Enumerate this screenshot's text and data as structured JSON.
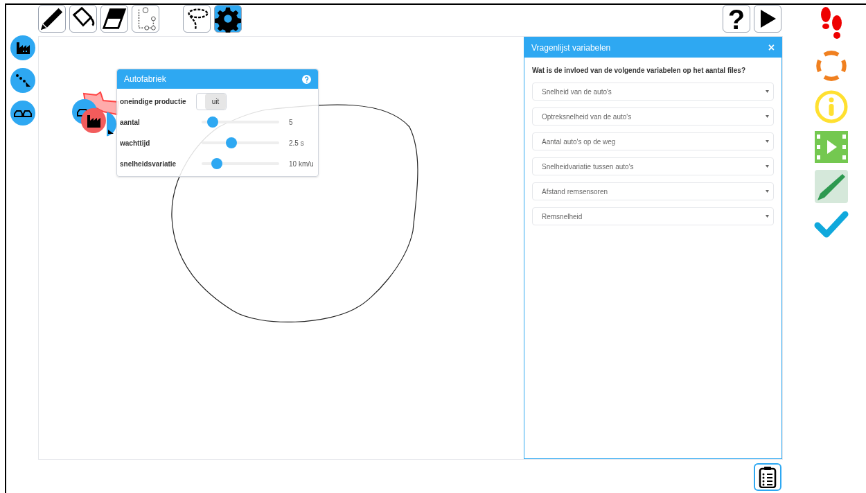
{
  "toolbar": {
    "tools": [
      {
        "kind": "pencil",
        "selected": false
      },
      {
        "kind": "bucket",
        "selected": false
      },
      {
        "kind": "eraser",
        "selected": false
      },
      {
        "kind": "select",
        "selected": false
      },
      {
        "kind": "lasso",
        "selected": false
      },
      {
        "kind": "gear",
        "selected": true
      }
    ],
    "help_label": "?"
  },
  "canvas": {
    "nodes": [
      {
        "kind": "car",
        "selected": false
      },
      {
        "kind": "factory",
        "selected": true
      }
    ]
  },
  "properties_panel": {
    "title": "Autofabriek",
    "rows": [
      {
        "kind": "toggle",
        "label": "oneindige productie",
        "value": "uit",
        "on": false
      },
      {
        "kind": "slider",
        "label": "aantal",
        "level": 0.14,
        "reading": "5"
      },
      {
        "kind": "slider",
        "label": "wachttijd",
        "level": 0.38,
        "reading": "2.5 s"
      },
      {
        "kind": "slider",
        "label": "snelheidsvariatie",
        "level": 0.2,
        "reading": "10 km/u"
      }
    ]
  },
  "questionnaire": {
    "title": "Vragenlijst variabelen",
    "close": "×",
    "question": "Wat is de invloed van de volgende variabelen op het aantal files?",
    "selects": [
      {
        "value": "Snelheid van de auto's"
      },
      {
        "value": "Optreksnelheid van de auto's"
      },
      {
        "value": "Aantal auto's op de weg"
      },
      {
        "value": "Snelheidvariatie tussen auto's"
      },
      {
        "value": "Afstand remsensoren"
      },
      {
        "value": "Remsnelheid"
      }
    ]
  }
}
